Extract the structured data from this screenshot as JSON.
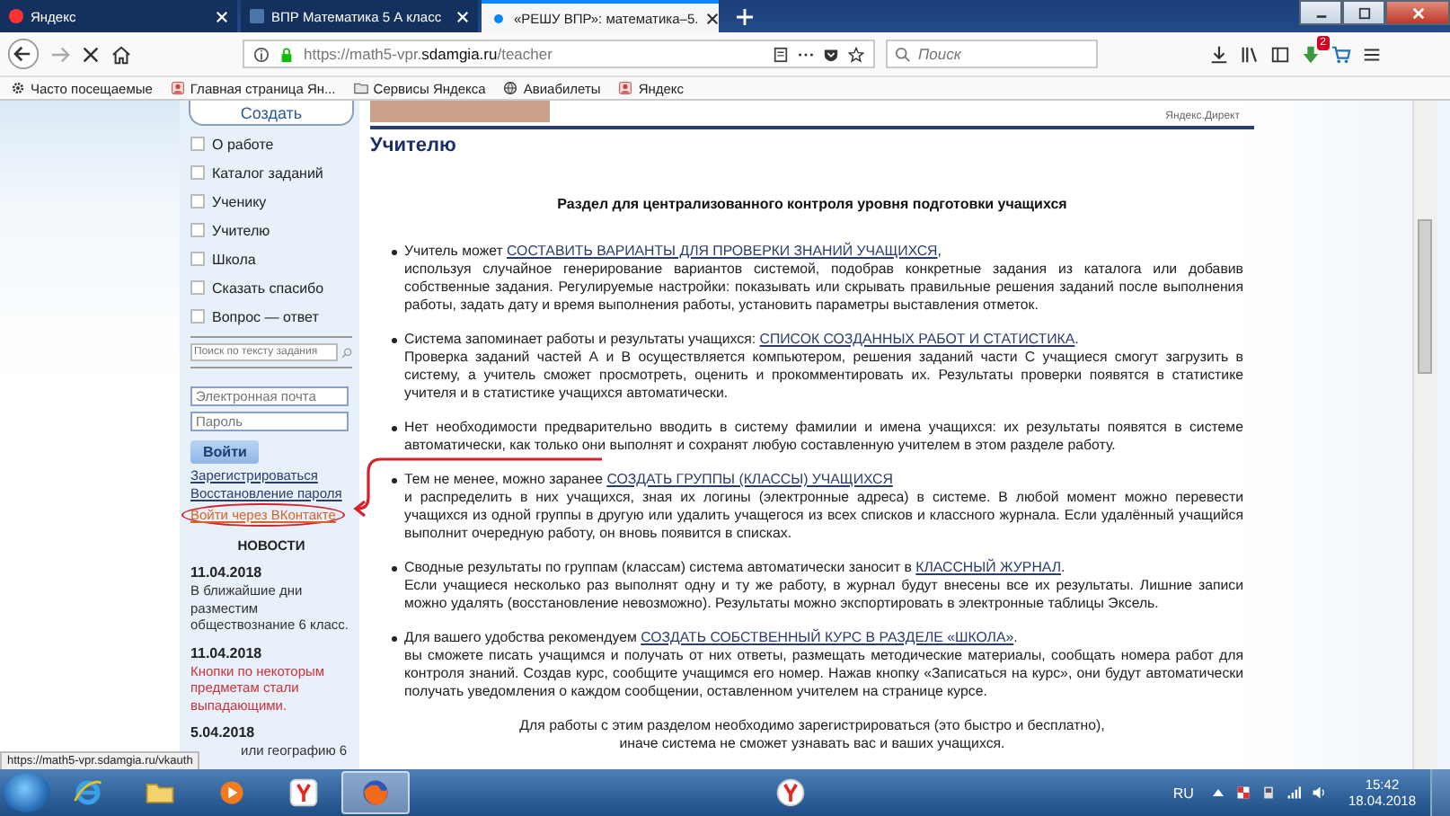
{
  "tabs": [
    {
      "label": "Яндекс",
      "selected": false
    },
    {
      "label": "ВПР Математика 5 А класс",
      "selected": false
    },
    {
      "label": "«РЕШУ ВПР»: математика–5.",
      "selected": true
    }
  ],
  "navbar": {
    "url_host": "https://math5-vpr.",
    "url_domain": "sdamgia.ru",
    "url_path": "/teacher",
    "search_placeholder": "Поиск",
    "badge": "2"
  },
  "bookmarks": [
    "Часто посещаемые",
    "Главная страница Ян...",
    "Сервисы Яндекса",
    "Авиабилеты",
    "Яндекс"
  ],
  "sidebar": {
    "create_button": "Создать",
    "menu": [
      "О работе",
      "Каталог заданий",
      "Ученику",
      "Учителю",
      "Школа",
      "Сказать спасибо",
      "Вопрос — ответ"
    ],
    "search_placeholder": "Поиск по тексту задания",
    "email_placeholder": "Электронная почта",
    "password_placeholder": "Пароль",
    "login_button": "Войти",
    "links": [
      {
        "label": "Зарегистрироваться",
        "kind": "plain"
      },
      {
        "label": "Восстановление пароля",
        "kind": "plain"
      },
      {
        "label": "Войти через ВКонтакте",
        "kind": "vk"
      }
    ],
    "news_title": "НОВОСТИ",
    "news": [
      {
        "date": "11.04.2018",
        "text": "В ближайшие дни разместим обществознание 6 класс.",
        "color": "#333333"
      },
      {
        "date": "11.04.2018",
        "text": "Кнопки по некоторым предметам стали выпадающими.",
        "color": "#d0303a"
      },
      {
        "date": "5.04.2018",
        "text": "или географию 6",
        "color": "#333333"
      }
    ]
  },
  "content": {
    "ad_label": "Яндекс.Директ",
    "title": "Учителю",
    "heading": "Раздел для централизованного контроля уровня подготовки учащихся",
    "items": [
      {
        "lead": "Учитель может ",
        "link": "СОСТАВИТЬ ВАРИАНТЫ ДЛЯ ПРОВЕРКИ ЗНАНИЙ УЧАЩИХСЯ",
        "tail": ",",
        "body": "используя случайное генерирование вариантов системой, подобрав конкретные задания из каталога или добавив собственные задания. Регулируемые настройки: показывать или скрывать правильные решения заданий после выполнения работы, задать дату и время выполнения работы, установить параметры выставления отметок."
      },
      {
        "lead": "Система запоминает работы и результаты учащихся: ",
        "link": "СПИСОК СОЗДАННЫХ РАБОТ И СТАТИСТИКА",
        "tail": ".",
        "body": "Проверка заданий частей А и В осуществляется компьютером, решения заданий части С учащиеся смогут загрузить в систему, а учитель сможет просмотреть, оценить и прокомментировать их. Результаты проверки появятся в статистике учителя и в статистике учащихся автоматически."
      },
      {
        "lead": "Нет необходимости предварительно вводить в систему фамилии и имена учащихся: их результаты появятся в системе автоматически, как только они выполнят и сохранят любую составленную учителем в этом разделе работу."
      },
      {
        "lead": "Тем не менее, можно заранее ",
        "link": "СОЗДАТЬ ГРУППЫ (КЛАССЫ) УЧАЩИХСЯ",
        "body": "и распределить в них учащихся, зная их логины (электронные адреса) в системе. В любой момент можно перевести учащихся из одной группы в другую или удалить учащегося из всех списков и классного журнала. Если удалённый учащийся выполнит очередную работу, он вновь появится в списках."
      },
      {
        "lead": "Сводные результаты по группам (классам) система автоматически заносит в ",
        "link": "КЛАССНЫЙ ЖУРНАЛ",
        "tail": ".",
        "body": "Если учащиеся несколько раз выполнят одну и ту же работу, в журнал будут внесены все их результаты. Лишние записи можно удалять (восстановление невозможно). Результаты можно экспортировать в электронные таблицы Эксель."
      },
      {
        "lead": "Для вашего удобства рекомендуем ",
        "link": "СОЗДАТЬ СОБСТВЕННЫЙ КУРС В РАЗДЕЛЕ «ШКОЛА»",
        "tail": ".",
        "body": "вы сможете писать учащимся и получать от них ответы, размещать методические материалы, сообщать номера работ для контроля знаний. Создав курс, сообщите учащимся его номер. Нажав кнопку «Записаться на курс», они будут автоматически получать уведомления о каждом сообщении, оставленном учителем на странице курсе."
      }
    ],
    "footer": "Для работы с этим разделом необходимо зарегистрироваться (это быстро и бесплатно),\nиначе система не сможет узнавать вас и ваших учащихся."
  },
  "status_url": "https://math5-vpr.sdamgia.ru/vkauth",
  "taskbar": {
    "apps": [
      {
        "kind": "ie",
        "active": false
      },
      {
        "kind": "folder",
        "active": false
      },
      {
        "kind": "media",
        "active": false
      },
      {
        "kind": "yandex",
        "active": false
      },
      {
        "kind": "firefox",
        "active": true
      }
    ],
    "pinned_right": [
      {
        "kind": "yandex",
        "active": false
      }
    ],
    "language": "RU",
    "time": "15:42",
    "date": "18.04.2018"
  }
}
